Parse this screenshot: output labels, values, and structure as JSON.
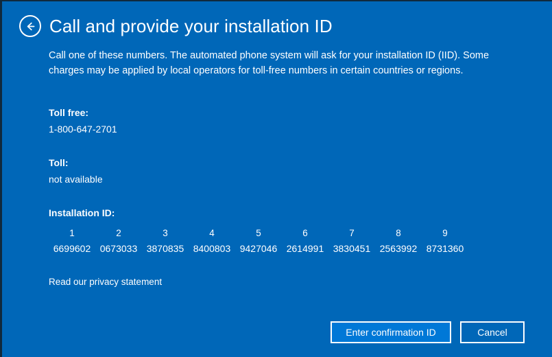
{
  "header": {
    "back_icon": "back-arrow-circle-icon",
    "title": "Call and provide your installation ID"
  },
  "body": {
    "intro": "Call one of these numbers. The automated phone system will ask for your installation ID (IID). Some charges may be applied by local operators for toll-free numbers in certain countries or regions.",
    "toll_free_label": "Toll free:",
    "toll_free_value": "1-800-647-2701",
    "toll_label": "Toll:",
    "toll_value": "not available",
    "installation_id_label": "Installation ID:",
    "installation_id_indexes": [
      "1",
      "2",
      "3",
      "4",
      "5",
      "6",
      "7",
      "8",
      "9"
    ],
    "installation_id_groups": [
      "6699602",
      "0673033",
      "3870835",
      "8400803",
      "9427046",
      "2614991",
      "3830451",
      "2563992",
      "8731360"
    ],
    "privacy_link": "Read our privacy statement"
  },
  "footer": {
    "primary_button": "Enter confirmation ID",
    "secondary_button": "Cancel"
  },
  "colors": {
    "background": "#0067b8",
    "primary_button": "#0078d7",
    "text": "#ffffff",
    "border": "#10293c"
  }
}
